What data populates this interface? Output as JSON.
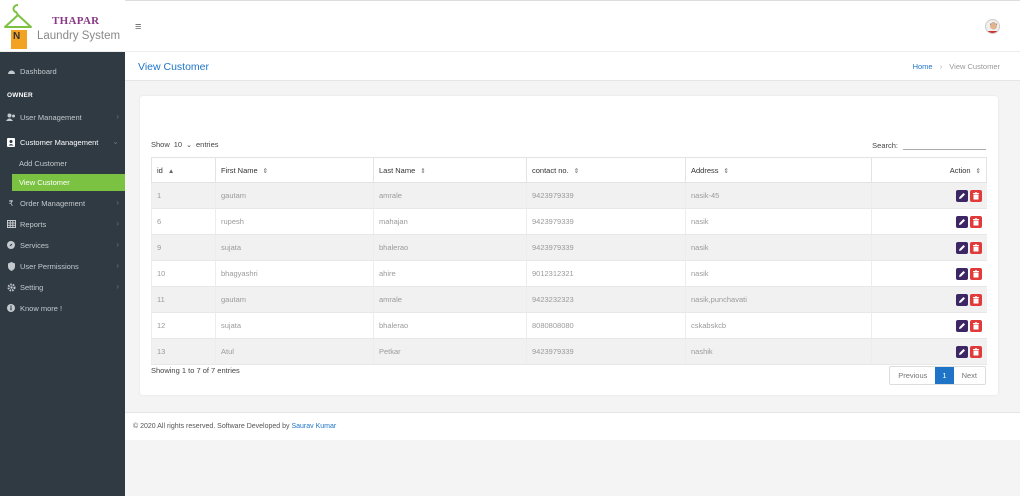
{
  "brand": {
    "title": "THAPAR",
    "subtitle": "Laundry System",
    "badge": "N"
  },
  "topbar": {
    "menu_glyph": "≡"
  },
  "sidebar": {
    "dashboard": "Dashboard",
    "owner_header": "OWNER",
    "user_management": "User Management",
    "customer_management": "Customer Management",
    "add_customer": "Add Customer",
    "view_customer": "View Customer",
    "order_management": "Order Management",
    "reports": "Reports",
    "services": "Services",
    "user_permissions": "User Permissions",
    "setting": "Setting",
    "know_more": "Know more !"
  },
  "page": {
    "title": "View Customer",
    "breadcrumb_home": "Home",
    "breadcrumb_current": "View Customer"
  },
  "table_controls": {
    "show_label": "Show",
    "entries_value": "10",
    "entries_label": "entries",
    "search_label": "Search:"
  },
  "table": {
    "columns": [
      "id",
      "First Name",
      "Last Name",
      "contact no.",
      "Address",
      "Action"
    ],
    "rows": [
      {
        "id": "1",
        "first": "gautam",
        "last": "amrale",
        "contact": "9423979339",
        "address": "nasik-45"
      },
      {
        "id": "6",
        "first": "rupesh",
        "last": "mahajan",
        "contact": "9423979339",
        "address": "nasik"
      },
      {
        "id": "9",
        "first": "sujata",
        "last": "bhalerao",
        "contact": "9423979339",
        "address": "nasik"
      },
      {
        "id": "10",
        "first": "bhagyashri",
        "last": "ahire",
        "contact": "9012312321",
        "address": "nasik"
      },
      {
        "id": "11",
        "first": "gautam",
        "last": "amrale",
        "contact": "9423232323",
        "address": "nasik,punchavati"
      },
      {
        "id": "12",
        "first": "sujata",
        "last": "bhalerao",
        "contact": "8080808080",
        "address": "cskabskcb"
      },
      {
        "id": "13",
        "first": "Atul",
        "last": "Petkar",
        "contact": "9423979339",
        "address": "nashik"
      }
    ]
  },
  "pagination": {
    "info": "Showing 1 to 7 of 7 entries",
    "previous": "Previous",
    "current": "1",
    "next": "Next"
  },
  "footer": {
    "text": "© 2020 All rights reserved. Software Developed by ",
    "developer": "Saurav Kumar"
  },
  "colors": {
    "accent": "#1f74c7",
    "sidebar_bg": "#2f3a43",
    "active_green": "#7cc242",
    "edit_button": "#3c2663",
    "delete_button": "#e03b3b"
  }
}
